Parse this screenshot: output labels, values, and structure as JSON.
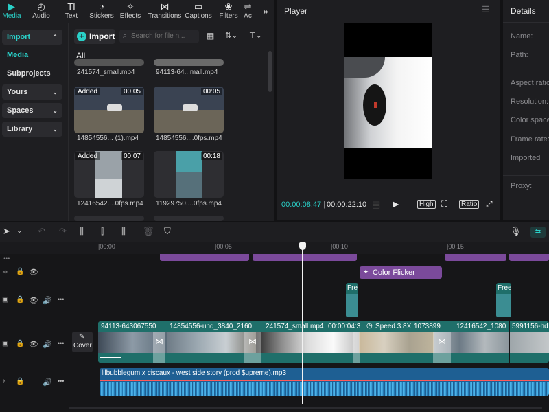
{
  "toolbar_tabs": [
    {
      "label": "Media",
      "icon": "play-square-icon",
      "active": true
    },
    {
      "label": "Audio",
      "icon": "audio-note-icon"
    },
    {
      "label": "Text",
      "icon": "text-icon"
    },
    {
      "label": "Stickers",
      "icon": "sticker-icon"
    },
    {
      "label": "Effects",
      "icon": "sparkle-icon"
    },
    {
      "label": "Transitions",
      "icon": "bowtie-icon"
    },
    {
      "label": "Captions",
      "icon": "captions-icon"
    },
    {
      "label": "Filters",
      "icon": "filters-icon"
    },
    {
      "label": "Ac",
      "icon": "adjust-icon"
    }
  ],
  "nav": {
    "import": "Import",
    "media": "Media",
    "subprojects": "Subprojects",
    "yours": "Yours",
    "spaces": "Spaces",
    "library": "Library"
  },
  "media": {
    "import_button": "Import",
    "search_placeholder": "Search for file n...",
    "all_label": "All",
    "items": [
      {
        "name": "241574_small.mp4",
        "badge": "",
        "duration": ""
      },
      {
        "name": "94113-64...mall.mp4",
        "badge": "",
        "duration": ""
      },
      {
        "name": "14854556... (1).mp4",
        "badge": "Added",
        "duration": "00:05"
      },
      {
        "name": "14854556....0fps.mp4",
        "badge": "",
        "duration": "00:05"
      },
      {
        "name": "12416542....0fps.mp4",
        "badge": "Added",
        "duration": "00:07"
      },
      {
        "name": "11929750....0fps.mp4",
        "badge": "",
        "duration": "00:18"
      }
    ]
  },
  "player": {
    "title": "Player",
    "current_time": "00:00:08:47",
    "total_time": "00:00:22:10",
    "high_label": "High",
    "ratio_label": "Ratio"
  },
  "details": {
    "title": "Details",
    "labels": [
      "Name:",
      "Path:",
      "Aspect ratio",
      "Resolution:",
      "Color space",
      "Frame rate:",
      "Imported",
      "Proxy:"
    ]
  },
  "timeline": {
    "ruler": [
      "|00:00",
      "|00:05",
      "|00:10",
      "|00:15"
    ],
    "cover_label": "Cover",
    "effect_clip": "Color Flicker",
    "free_label": "Free",
    "video_clips": [
      "94113-643067550",
      "14854556-uhd_3840_2160",
      "241574_small.mp4",
      "00:00:04:3",
      "Speed 3.8X",
      "1073899",
      "12416542_1080",
      "5991156-hd"
    ],
    "audio_clip": "lilbubblegum x ciscaux - west side story (prod $upreme).mp3"
  },
  "colors": {
    "accent": "#2ad0c8",
    "video_track": "#1f6f6a",
    "audio_track": "#1e5f93",
    "effect_clip": "#7b4a9b"
  }
}
